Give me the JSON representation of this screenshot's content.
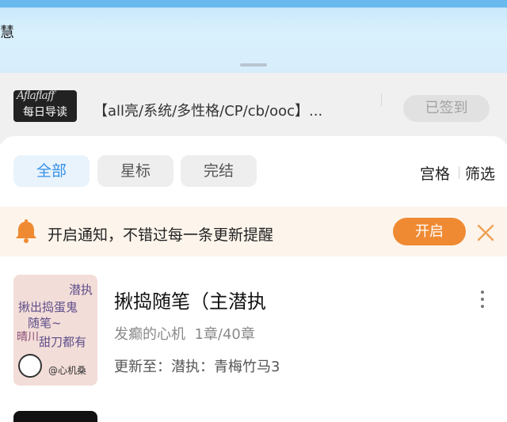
{
  "top": {
    "partial_text": "慧"
  },
  "reading": {
    "thumb_script": "Aflaflaff",
    "thumb_label": "每日导读",
    "title": "【all亮/系统/多性格/CP/cb/ooc】...",
    "signed_label": "已签到"
  },
  "tabs": [
    {
      "label": "全部",
      "active": true
    },
    {
      "label": "星标",
      "active": false
    },
    {
      "label": "完结",
      "active": false
    }
  ],
  "tools": {
    "grid_label": "宫格",
    "filter_label": "筛选"
  },
  "notice": {
    "text": "开启通知，不错过每一条更新提醒",
    "button_label": "开启",
    "bell_color": "#f08a32"
  },
  "book": {
    "cover_lines": [
      "潜执",
      "揪出捣蛋鬼",
      "随笔~",
      "甜刀都有",
      "晴川"
    ],
    "cover_author": "@心机桑",
    "title": "揪捣随笔（主潜执",
    "author": "发癫的心机",
    "chapters": "1章/40章",
    "update": "更新至：潜执：青梅竹马3"
  },
  "colors": {
    "accent_blue": "#3590e8",
    "orange": "#f08a32"
  }
}
